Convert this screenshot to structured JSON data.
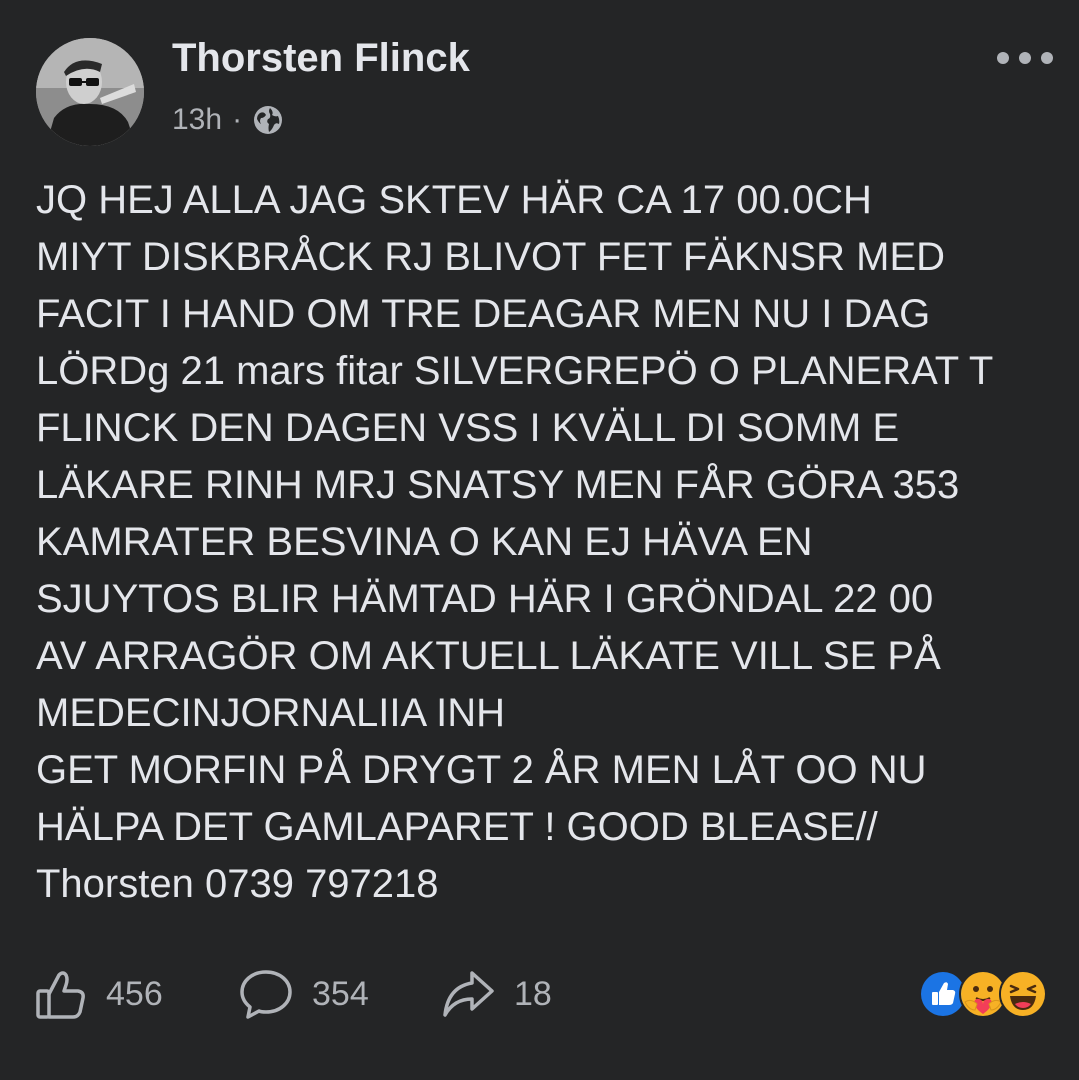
{
  "post": {
    "author_name": "Thorsten Flinck",
    "timestamp": "13h",
    "separator": "·",
    "audience_icon": "globe-icon",
    "more_icon": "more-dots-icon",
    "text": "JQ HEJ ALLA JAG SKTEV HÄR CA 17 00.0CH\nMIYT DISKBRÅCK  RJ BLIVOT FET FÄKNSR MED\nFACIT I HAND OM TRE DEAGAR MEN NU I DAG\nLÖRDg 21 mars fitar SILVERGREPÖ O PLANERAT T\nFLINCK DEN DAGEN VSS I KVÄLL DI SOMM E\nLÄKARE RINH MRJ SNATSY MEN FÅR GÖRA 353\nKAMRATER BESVINA O KAN EJ HÄVA EN\nSJUYTOS BLIR HÄMTAD HÄR I GRÖNDAL 22 00\nAV ARRAGÖR   OM AKTUELL LÄKATE VILL SE PÅ\nMEDECINJORNALIIA INH\nGET MORFIN PÅ DRYGT 2 ÅR MEN LÅT OO NU\nHÄLPA DET GAMLAPARET ! GOOD BLEASE//\nThorsten  0739 797218"
  },
  "actions": {
    "like_count": "456",
    "comment_count": "354",
    "share_count": "18"
  },
  "reactions": [
    "like",
    "care",
    "haha"
  ],
  "colors": {
    "background": "#242526",
    "text": "#e4e6eb",
    "secondary_text": "#b0b3b8",
    "like_blue": "#1b74e4",
    "reaction_yellow": "#f7b125"
  }
}
